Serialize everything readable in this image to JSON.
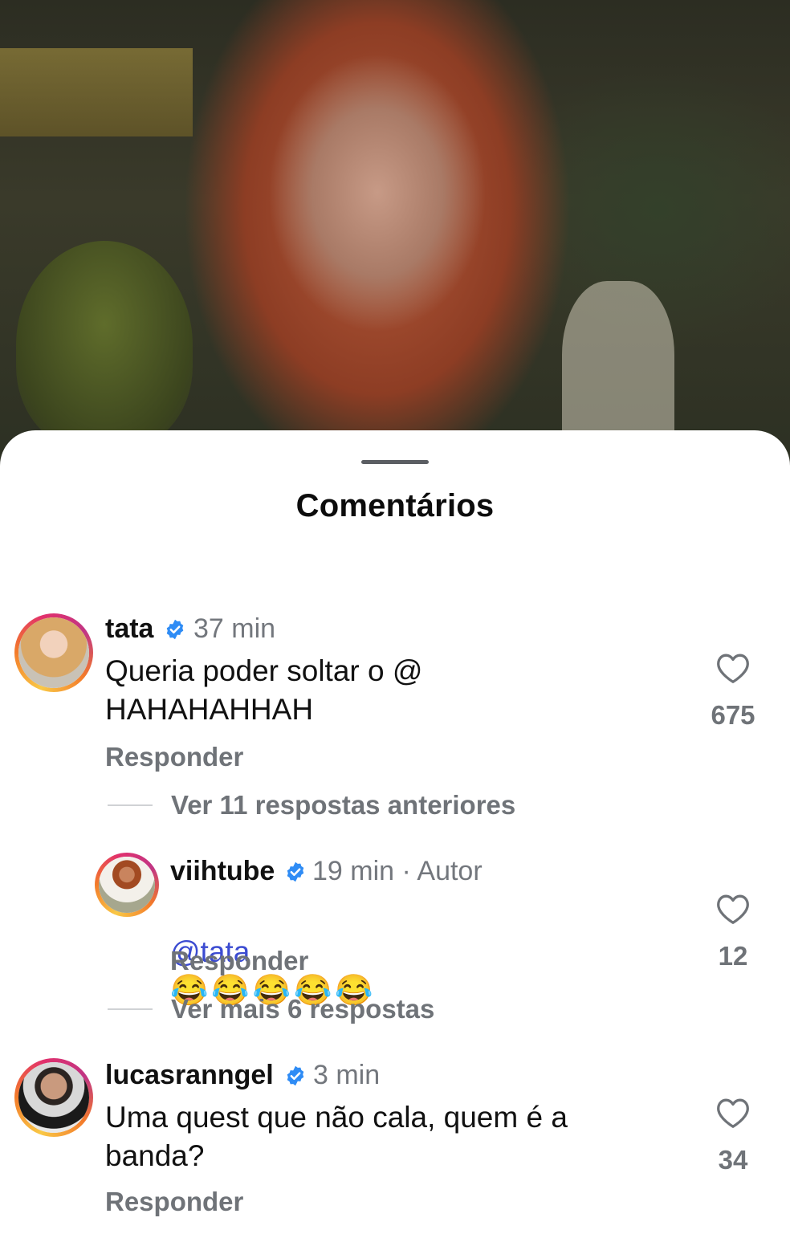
{
  "sheet": {
    "title": "Comentários"
  },
  "colors": {
    "mention": "#3b4bd1",
    "verified": "#2f8cf5",
    "muted": "#6f7378"
  },
  "comments": [
    {
      "username": "tata",
      "verified": true,
      "time": "37 min",
      "text": "Queria poder soltar o @\nHAHAHAHHAH",
      "reply_label": "Responder",
      "likes": "675",
      "view_replies": "Ver 11 respostas anteriores"
    },
    {
      "username": "viihtube",
      "verified": true,
      "time": "19 min · Autor",
      "mention": "@tata",
      "emojis": "😂😂😂😂😂",
      "reply_label": "Responder",
      "likes": "12",
      "view_replies": "Ver mais 6 respostas"
    },
    {
      "username": "lucasranngel",
      "verified": true,
      "time": "3 min",
      "text": "Uma quest que não cala, quem é a\nbanda?",
      "reply_label": "Responder",
      "likes": "34"
    }
  ],
  "icons": {
    "like": "heart-outline-icon",
    "verified": "verified-badge-icon"
  }
}
